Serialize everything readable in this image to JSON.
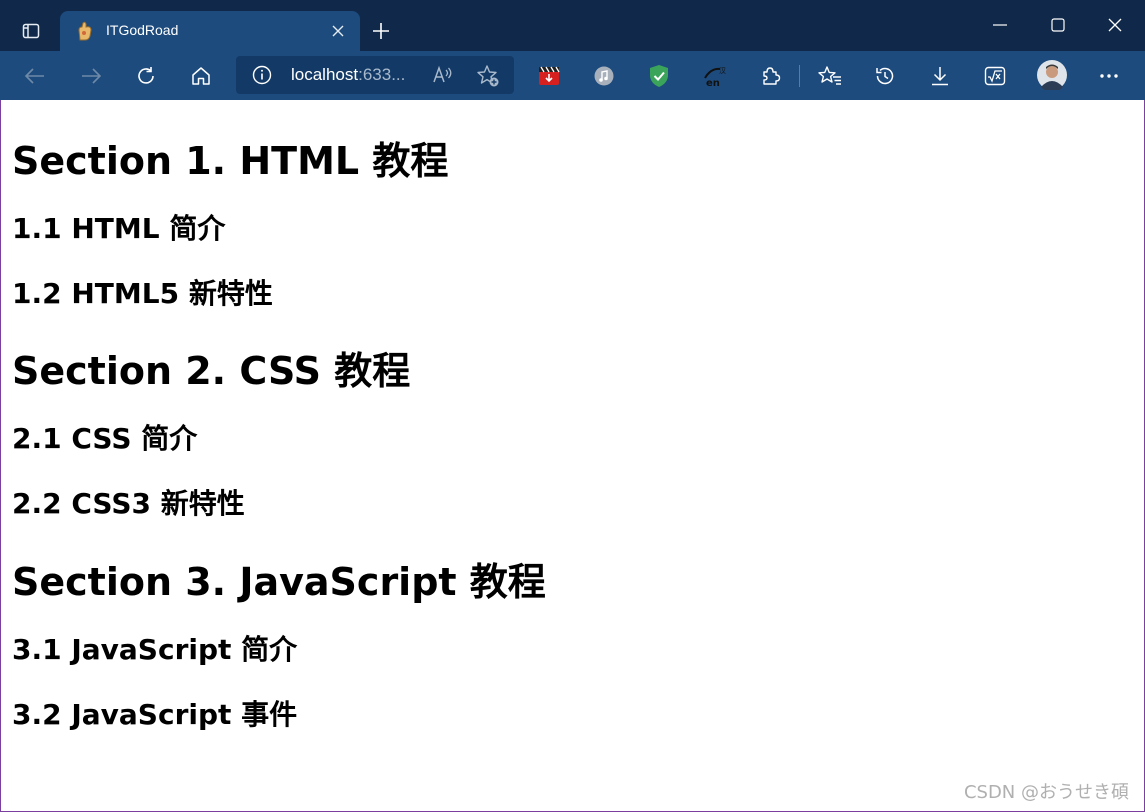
{
  "browser": {
    "tab": {
      "title": "ITGodRoad"
    },
    "address": {
      "host": "localhost",
      "rest": ":633..."
    },
    "icons": {
      "tab_actions": "tab-actions-icon",
      "new_tab": "plus-icon",
      "back": "back-arrow-icon",
      "forward": "forward-arrow-icon",
      "refresh": "refresh-icon",
      "home": "home-icon",
      "info": "info-icon",
      "read_aloud": "read-aloud-icon",
      "add_favorite": "add-favorite-icon",
      "extensions": [
        "video-download-extension-icon",
        "music-extension-icon",
        "shield-extension-icon",
        "translate-extension-icon"
      ],
      "extensions_menu": "puzzle-icon",
      "favorites": "favorites-icon",
      "history": "history-icon",
      "downloads": "download-icon",
      "math": "math-solver-icon",
      "profile": "avatar",
      "more": "more-icon"
    },
    "colors": {
      "titlebar": "#10294a",
      "toolbar": "#1d4b7d",
      "address": "#133a66"
    }
  },
  "page": {
    "sections": [
      {
        "heading": "Section 1. HTML 教程",
        "items": [
          "1.1 HTML 简介",
          "1.2 HTML5 新特性"
        ]
      },
      {
        "heading": "Section 2. CSS 教程",
        "items": [
          "2.1 CSS 简介",
          "2.2 CSS3 新特性"
        ]
      },
      {
        "heading": "Section 3. JavaScript 教程",
        "items": [
          "3.1 JavaScript 简介",
          "3.2 JavaScript 事件"
        ]
      }
    ]
  },
  "watermark": "CSDN @おうせき碩"
}
